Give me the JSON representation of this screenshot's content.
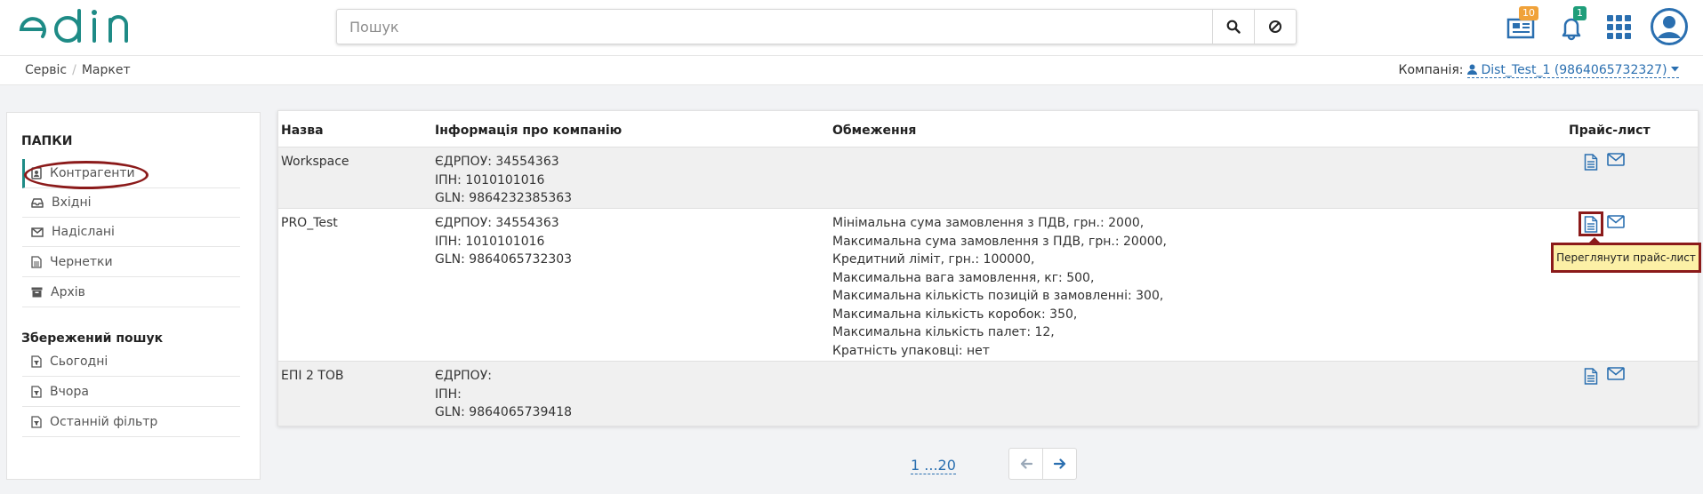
{
  "header": {
    "logo_text": "edin",
    "search": {
      "placeholder": "Пошук",
      "value": ""
    },
    "news_badge": "10",
    "notifications_badge": "1"
  },
  "breadcrumb": {
    "items": [
      "Сервіс",
      "Маркет"
    ]
  },
  "company": {
    "label": "Компанія:",
    "value": "Dist_Test_1 (9864065732327)"
  },
  "sidebar": {
    "folders_title": "ПАПКИ",
    "folders": [
      "Контрагенти",
      "Вхідні",
      "Надіслані",
      "Чернетки",
      "Архів"
    ],
    "saved_title": "Збережений пошук",
    "saved": [
      "Сьогодні",
      "Вчора",
      "Останній фільтр"
    ]
  },
  "table": {
    "headers": [
      "Назва",
      "Інформація про компанію",
      "Обмеження",
      "Прайс-лист"
    ],
    "rows": [
      {
        "name": "Workspace",
        "info": [
          "ЄДРПОУ: 34554363",
          "ІПН: 1010101016",
          "GLN: 9864232385363"
        ],
        "limits": []
      },
      {
        "name": "PRO_Test",
        "info": [
          "ЄДРПОУ: 34554363",
          "ІПН: 1010101016",
          "GLN: 9864065732303"
        ],
        "limits": [
          "Мінімальна сума замовлення з ПДВ, грн.: 2000,",
          "Максимальна сума замовлення з ПДВ, грн.: 20000,",
          "Кредитний ліміт, грн.: 100000,",
          "Максимальна вага замовлення, кг: 500,",
          "Максимальна кількість позицій в замовленні: 300,",
          "Максимальна кількість коробок: 350,",
          "Максимальна кількість палет: 12,",
          "Кратність упаковці: нет"
        ]
      },
      {
        "name": "ЕПІ 2 ТОВ",
        "info": [
          "ЄДРПОУ:",
          "ІПН:",
          "GLN: 9864065739418"
        ],
        "limits": []
      }
    ]
  },
  "tooltip": "Переглянути прайс-лист",
  "pagination": {
    "range_label": "1 ...20"
  },
  "colors": {
    "brand": "#1e8b86",
    "link": "#2a6fb0",
    "highlight": "#8b1a1a",
    "tooltip_bg": "#fcf0a6"
  }
}
